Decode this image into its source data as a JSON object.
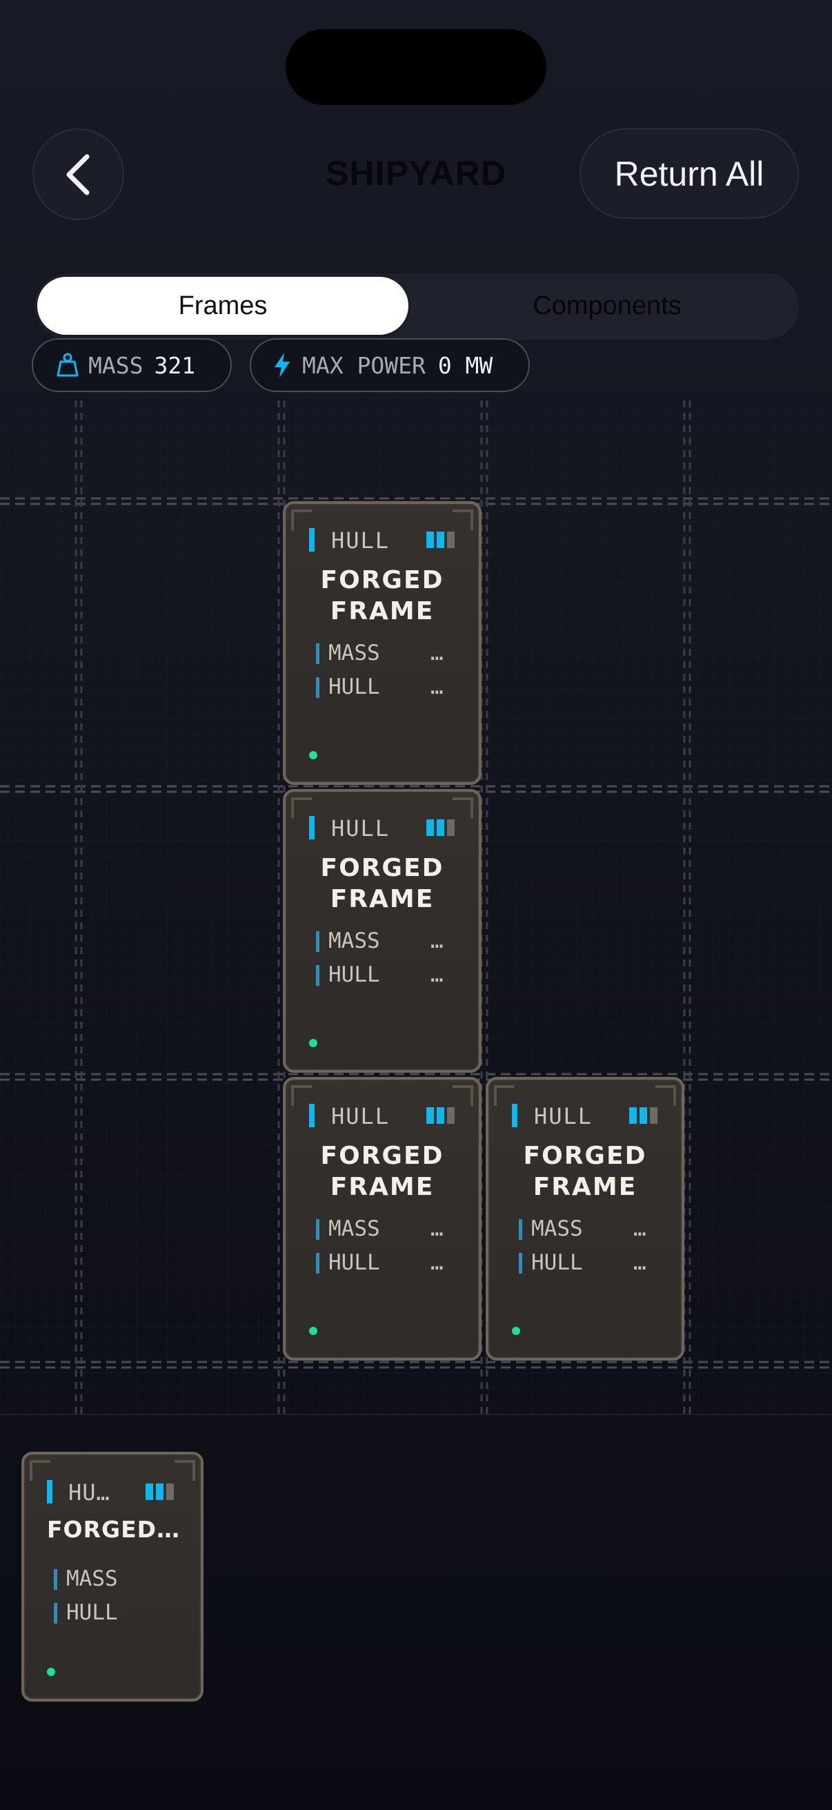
{
  "header": {
    "title": "SHIPYARD",
    "back_label": "",
    "return_all_label": "Return All"
  },
  "tabs": [
    {
      "label": "Frames",
      "active": true
    },
    {
      "label": "Components",
      "active": false
    }
  ],
  "stats": {
    "mass_label": "MASS",
    "mass_value": "321",
    "power_label": "MAX POWER",
    "power_value": "0 MW"
  },
  "cards": [
    {
      "type": "HULL",
      "name_line1": "FORGED",
      "name_line2": "FRAME",
      "stat1": "MASS",
      "stat2": "HULL",
      "stat1_value": "…",
      "stat2_value": "…"
    },
    {
      "type": "HULL",
      "name_line1": "FORGED",
      "name_line2": "FRAME",
      "stat1": "MASS",
      "stat2": "HULL",
      "stat1_value": "…",
      "stat2_value": "…"
    },
    {
      "type": "HULL",
      "name_line1": "FORGED",
      "name_line2": "FRAME",
      "stat1": "MASS",
      "stat2": "HULL",
      "stat1_value": "…",
      "stat2_value": "…"
    },
    {
      "type": "HULL",
      "name_line1": "FORGED",
      "name_line2": "FRAME",
      "stat1": "MASS",
      "stat2": "HULL",
      "stat1_value": "…",
      "stat2_value": "…"
    }
  ],
  "tray_card": {
    "type": "HU…",
    "name": "FORGED…",
    "stat1": "MASS",
    "stat2": "HULL"
  },
  "colors": {
    "accent": "#11b6ef",
    "status_dot": "#1ee08f",
    "card_border": "#6e665b"
  }
}
